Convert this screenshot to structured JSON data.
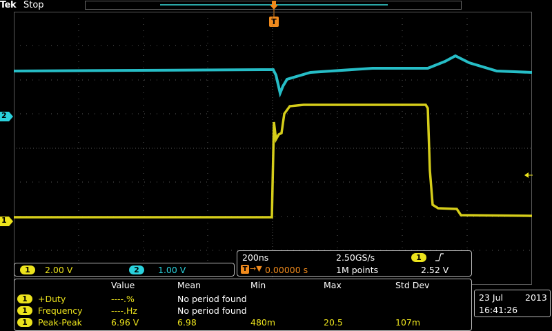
{
  "header": {
    "brand": "Tek",
    "status": "Stop",
    "trigger_marker": "T"
  },
  "channel_markers": {
    "ch2": "2",
    "ch1": "1"
  },
  "channels": [
    {
      "badge": "1",
      "scale": "2.00 V",
      "color": "#ece31d"
    },
    {
      "badge": "2",
      "scale": "1.00 V",
      "color": "#2ad1dc"
    }
  ],
  "timebase": {
    "time_per_div": "200ns",
    "sample_rate": "2.50GS/s",
    "trigger_icon": "T",
    "position": "0.00000 s",
    "record_length": "1M points",
    "trigger_source": "1",
    "trigger_slope_icon": "rising-edge-icon",
    "trigger_level": "2.52 V"
  },
  "measurements": {
    "headers": [
      "Value",
      "Mean",
      "Min",
      "Max",
      "Std Dev"
    ],
    "rows": [
      {
        "source": "1",
        "name": "+Duty",
        "value": "----.%",
        "mean": "No period found",
        "min": "",
        "max": "",
        "std": ""
      },
      {
        "source": "1",
        "name": "Frequency",
        "value": "----.Hz",
        "mean": "No period found",
        "min": "",
        "max": "",
        "std": ""
      },
      {
        "source": "1",
        "name": "Peak-Peak",
        "value": "6.96 V",
        "mean": "6.98",
        "min": "480m",
        "max": "20.5",
        "std": "107m"
      }
    ]
  },
  "clock": {
    "date": "23 Jul",
    "year": "2013",
    "time": "16:41:26"
  },
  "colors": {
    "ch1": "#ece31d",
    "ch2": "#2ad1dc",
    "trigger": "#f08a1c",
    "graticule": "#5a5a5a"
  }
}
